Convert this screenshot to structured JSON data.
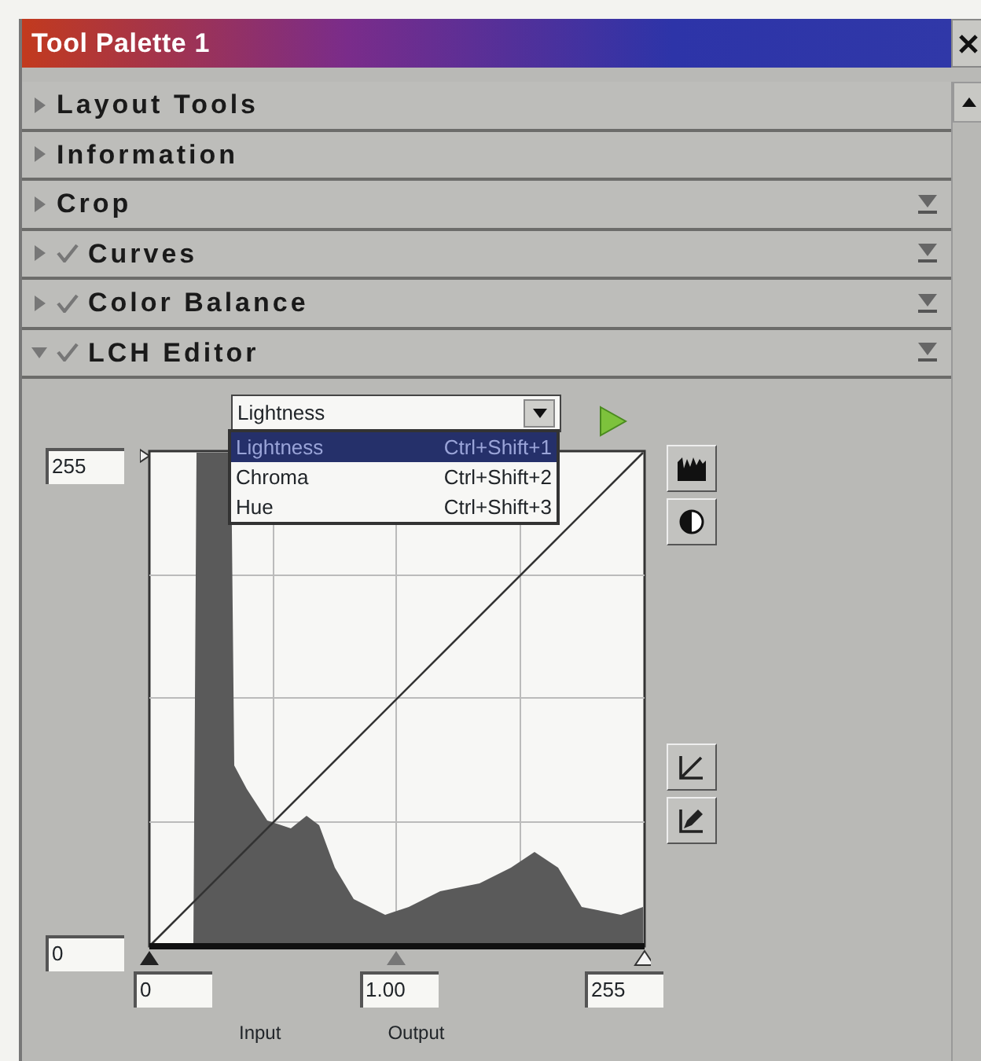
{
  "window": {
    "title": "Tool Palette 1"
  },
  "sections": [
    {
      "label": "Layout Tools",
      "expanded": false,
      "checked": false,
      "has_menu": false
    },
    {
      "label": "Information",
      "expanded": false,
      "checked": false,
      "has_menu": false
    },
    {
      "label": "Crop",
      "expanded": false,
      "checked": false,
      "has_menu": true
    },
    {
      "label": "Curves",
      "expanded": false,
      "checked": true,
      "has_menu": true
    },
    {
      "label": "Color Balance",
      "expanded": false,
      "checked": true,
      "has_menu": true
    },
    {
      "label": "LCH Editor",
      "expanded": true,
      "checked": true,
      "has_menu": true
    }
  ],
  "lch_editor": {
    "channel_select": {
      "value": "Lightness",
      "open": true,
      "options": [
        {
          "label": "Lightness",
          "shortcut": "Ctrl+Shift+1",
          "selected": true
        },
        {
          "label": "Chroma",
          "shortcut": "Ctrl+Shift+2",
          "selected": false
        },
        {
          "label": "Hue",
          "shortcut": "Ctrl+Shift+3",
          "selected": false
        }
      ]
    },
    "output_max": "255",
    "output_min": "0",
    "input_black": "0",
    "gamma": "1.00",
    "input_white": "255",
    "input_label": "Input",
    "output_label": "Output"
  }
}
